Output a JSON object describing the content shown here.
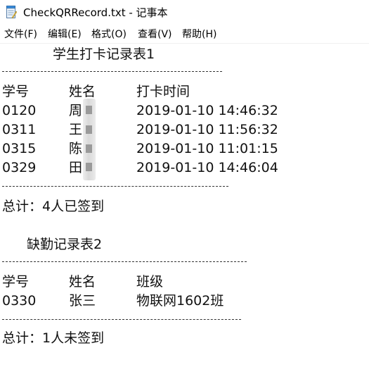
{
  "window": {
    "title": "CheckQRRecord.txt - 记事本",
    "icon": "notepad-icon"
  },
  "menu": {
    "file": "文件(F)",
    "edit": "编辑(E)",
    "format": "格式(O)",
    "view": "查看(V)",
    "help": "帮助(H)"
  },
  "record1": {
    "title": "学生打卡记录表1",
    "headers": [
      "学号",
      "姓名",
      "打卡时间"
    ],
    "rows": [
      {
        "id": "0120",
        "name": "周",
        "time": "2019-01-10 14:46:32"
      },
      {
        "id": "0311",
        "name": "王",
        "time": "2019-01-10 11:56:32"
      },
      {
        "id": "0315",
        "name": "陈",
        "time": "2019-01-10 11:01:15"
      },
      {
        "id": "0329",
        "name": "田",
        "time": "2019-01-10 14:46:04"
      }
    ],
    "separator_top": "----------------------------------------",
    "separator_bottom": "------------------------------------------",
    "total": "总计：4人已签到"
  },
  "record2": {
    "title": "缺勤记录表2",
    "headers": [
      "学号",
      "姓名",
      "班级"
    ],
    "rows": [
      {
        "id": "0330",
        "name": "张三",
        "class": "物联网1602班"
      }
    ],
    "separator_top": "---------------------------------------------",
    "separator_bottom": "-------------------------------------------",
    "total": "总计：1人未签到"
  }
}
